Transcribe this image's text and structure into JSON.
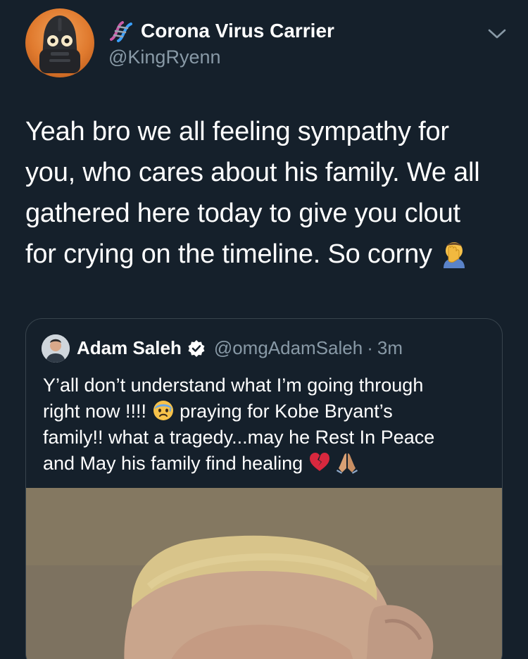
{
  "author": {
    "display_name": "Corona Virus Carrier",
    "handle": "@KingRyenn",
    "avatar_icon": "iron-giant-avatar",
    "name_icon": "dna-icon"
  },
  "tweet": {
    "lines": [
      "Yeah bro we all feeling sympathy for",
      "you, who cares about his family. We all",
      "gathered here today to give you clout",
      "for crying on the timeline. So corny"
    ],
    "trailing_emoji": "man-facepalming-emoji"
  },
  "quoted_tweet": {
    "display_name": "Adam Saleh",
    "verified": true,
    "handle": "@omgAdamSaleh",
    "separator": "·",
    "time": "3m",
    "lines": [
      "Y’all don’t understand what I’m going through",
      "right now !!!!",
      "praying for Kobe Bryant’s",
      "family!! what a tragedy...may he Rest In Peace",
      "and May his family find healing"
    ],
    "emojis": [
      "anxious-face-emoji",
      "broken-heart-emoji",
      "folded-hands-emoji"
    ],
    "media": "video-thumbnail"
  },
  "colors": {
    "background": "#15202b",
    "text": "#ffffff",
    "secondary_text": "#8899a6",
    "border": "#38444d",
    "verified_badge": "#ffffff"
  }
}
